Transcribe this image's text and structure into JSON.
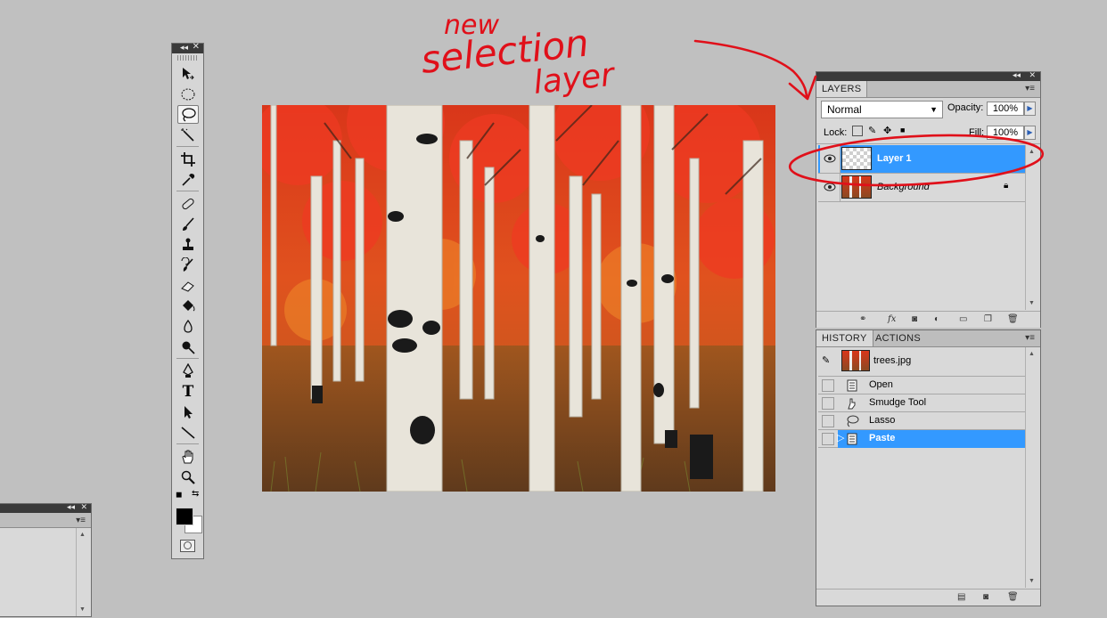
{
  "annotation": {
    "lines": [
      "new",
      "selection",
      "layer"
    ],
    "color": "#e0101a"
  },
  "layers_panel": {
    "tab": "LAYERS",
    "blend_mode": "Normal",
    "opacity_label": "Opacity:",
    "opacity_value": "100%",
    "lock_label": "Lock:",
    "fill_label": "Fill:",
    "fill_value": "100%",
    "layers": [
      {
        "name": "Layer 1",
        "selected": true,
        "italic": false,
        "locked": false
      },
      {
        "name": "Background",
        "selected": false,
        "italic": true,
        "locked": true
      }
    ]
  },
  "history_panel": {
    "tabs": [
      "HISTORY",
      "ACTIONS"
    ],
    "snapshot": "trees.jpg",
    "states": [
      {
        "name": "Open",
        "icon": "open-document-icon",
        "selected": false
      },
      {
        "name": "Smudge Tool",
        "icon": "smudge-tool-icon",
        "selected": false
      },
      {
        "name": "Lasso",
        "icon": "lasso-icon",
        "selected": false
      },
      {
        "name": "Paste",
        "icon": "paste-document-icon",
        "selected": true
      }
    ]
  },
  "tools": [
    "move-tool-icon",
    "elliptical-marquee-tool-icon",
    "lasso-tool-icon",
    "magic-wand-tool-icon",
    "crop-tool-icon",
    "eyedropper-tool-icon",
    "healing-brush-tool-icon",
    "brush-tool-icon",
    "clone-stamp-tool-icon",
    "history-brush-tool-icon",
    "eraser-tool-icon",
    "paint-bucket-tool-icon",
    "blur-tool-icon",
    "dodge-tool-icon",
    "pen-tool-icon",
    "type-tool-icon",
    "path-selection-tool-icon",
    "line-tool-icon",
    "hand-tool-icon",
    "zoom-tool-icon"
  ],
  "selection_highlight": "#3399ff",
  "type_tool_glyph": "T"
}
